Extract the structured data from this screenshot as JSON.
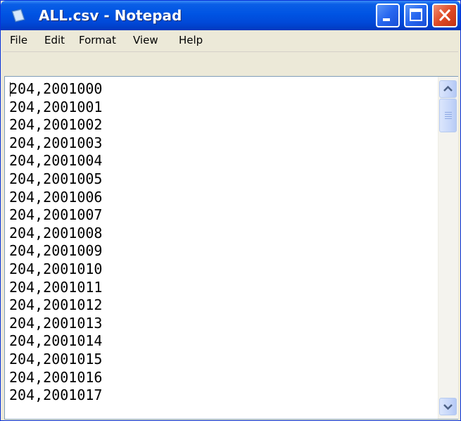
{
  "window": {
    "title": "ALL.csv - Notepad",
    "accent_color": "#0054e3",
    "close_color": "#e04a25"
  },
  "icons": {
    "app": "notepad-icon",
    "minimize": "minimize-icon",
    "maximize": "maximize-icon",
    "close": "close-icon",
    "scroll_up": "arrow-up-icon",
    "scroll_down": "arrow-down-icon"
  },
  "menu": {
    "items": [
      {
        "label": "File"
      },
      {
        "label": "Edit"
      },
      {
        "label": "Format"
      },
      {
        "label": "View"
      },
      {
        "label": "Help"
      }
    ]
  },
  "editor": {
    "lines": [
      "204,2001000",
      "204,2001001",
      "204,2001002",
      "204,2001003",
      "204,2001004",
      "204,2001005",
      "204,2001006",
      "204,2001007",
      "204,2001008",
      "204,2001009",
      "204,2001010",
      "204,2001011",
      "204,2001012",
      "204,2001013",
      "204,2001014",
      "204,2001015",
      "204,2001016",
      "204,2001017"
    ]
  }
}
